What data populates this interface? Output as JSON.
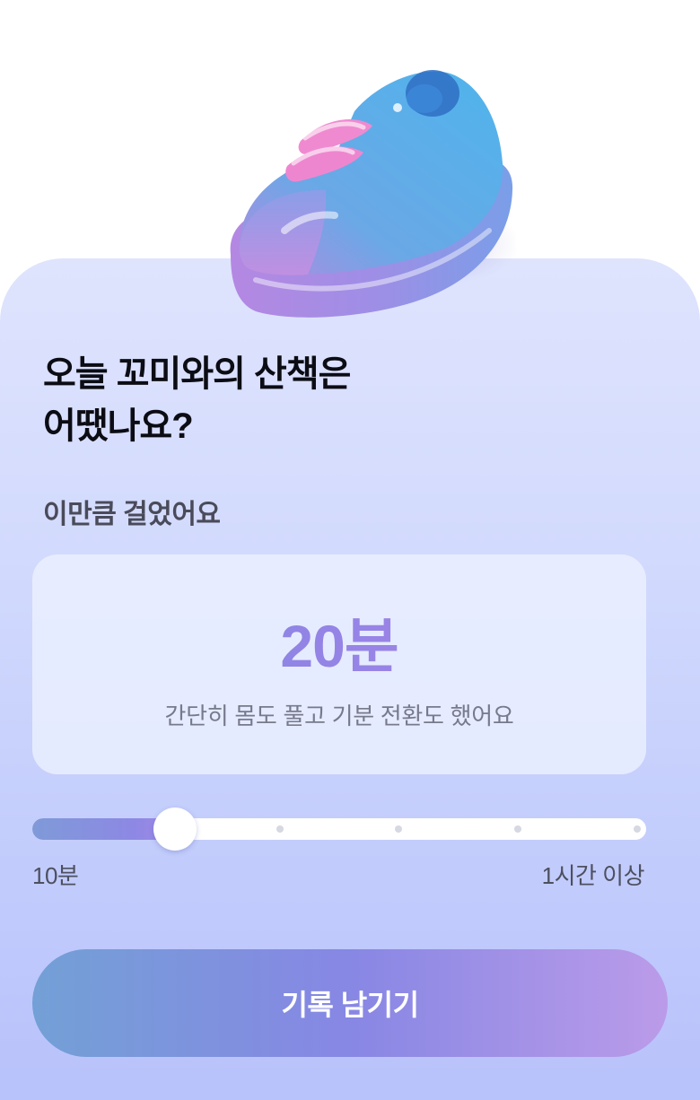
{
  "hero": {
    "icon": "shoe-icon"
  },
  "question": {
    "line1": "오늘 꼬미와의 산책은",
    "line2": "어땠나요?"
  },
  "walk": {
    "label": "이만큼 걸었어요",
    "value": "20분",
    "description": "간단히 몸도 풀고 기분 전환도 했어요"
  },
  "slider": {
    "min_label": "10분",
    "max_label": "1시간 이상",
    "value_fraction": 0.21,
    "step_count": 6
  },
  "cta": {
    "label": "기록 남기기"
  },
  "colors": {
    "accent_start": "#73a0d6",
    "accent_mid": "#8787e4",
    "accent_end": "#bb9be9",
    "background": "#d2dafd"
  }
}
